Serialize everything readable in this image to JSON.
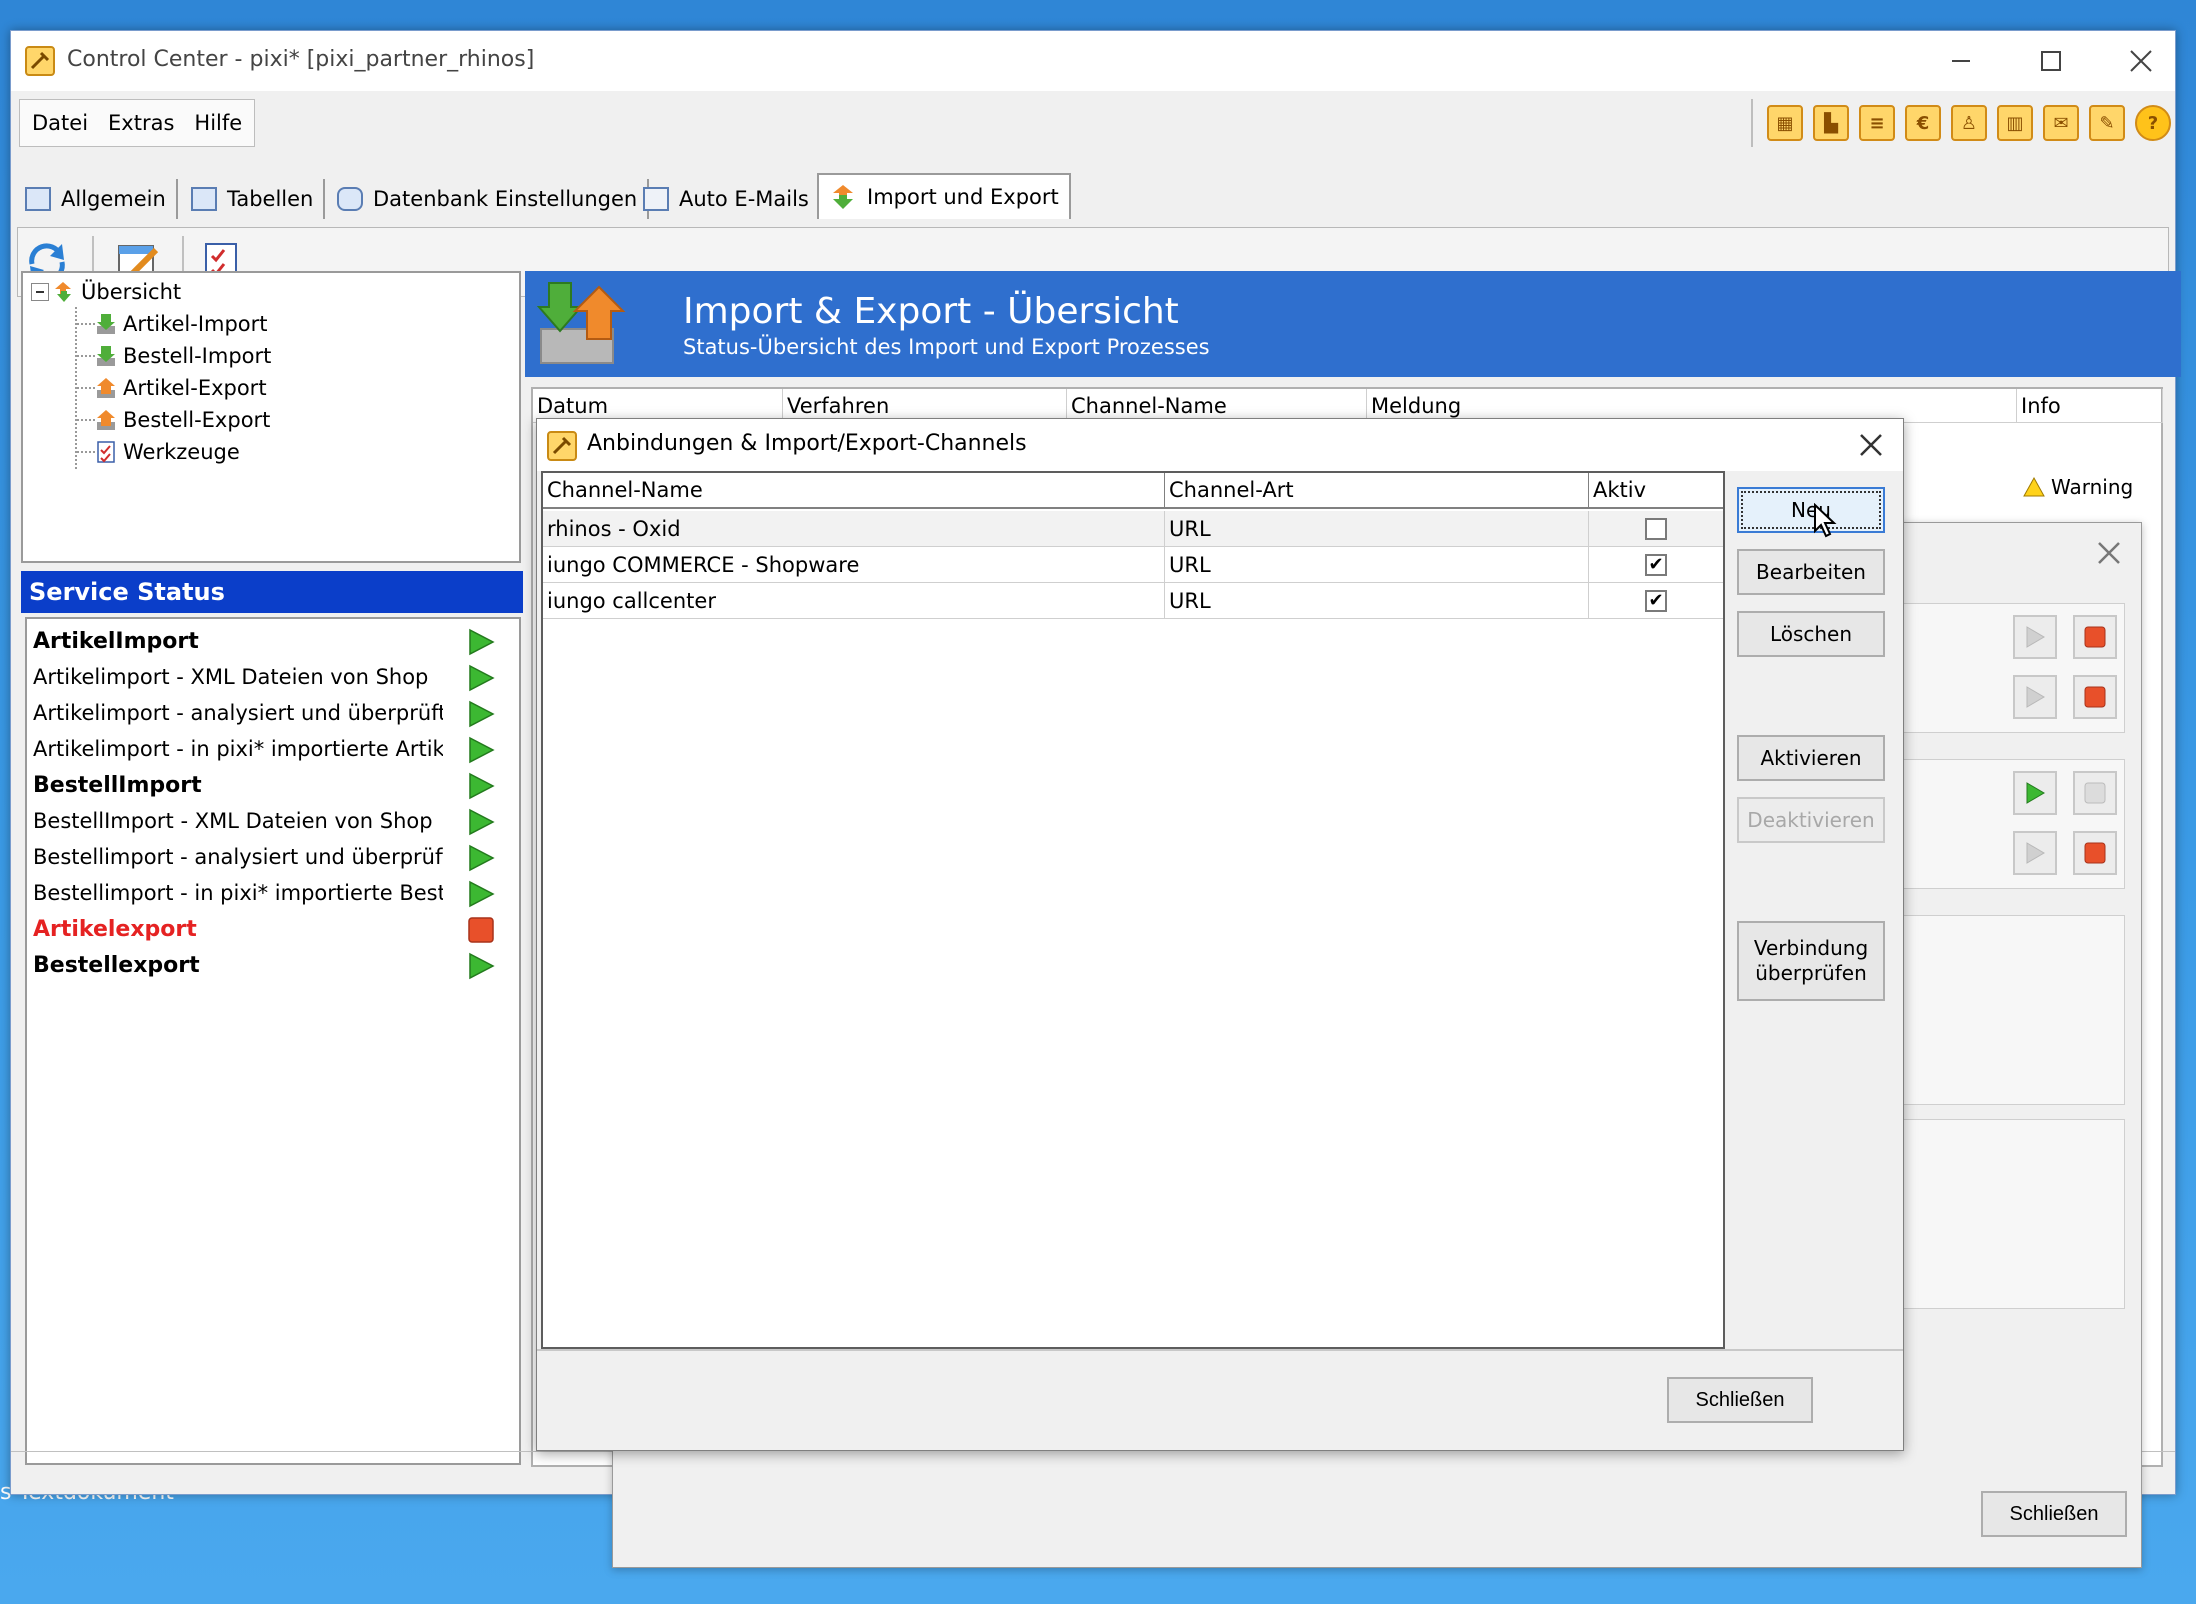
{
  "window": {
    "title": "Control Center - pixi* [pixi_partner_rhinos]"
  },
  "menu": [
    {
      "label": "Datei"
    },
    {
      "label": "Extras"
    },
    {
      "label": "Hilfe"
    }
  ],
  "toolbar_icons": [
    "table-icon",
    "hierarchy-icon",
    "document-icon",
    "euro-icon",
    "user-icon",
    "chart-icon",
    "mail-icon",
    "plugin-icon",
    "help-icon"
  ],
  "toolbar_icon_glyphs": [
    "▦",
    "▙",
    "≡",
    "€",
    "♙",
    "▥",
    "✉",
    "✎",
    "?"
  ],
  "tabs": [
    {
      "label": "Allgemein"
    },
    {
      "label": "Tabellen"
    },
    {
      "label": "Datenbank Einstellungen"
    },
    {
      "label": "Auto E-Mails"
    },
    {
      "label": "Import und Export"
    }
  ],
  "tree": {
    "root": "Übersicht",
    "items": [
      "Artikel-Import",
      "Bestell-Import",
      "Artikel-Export",
      "Bestell-Export",
      "Werkzeuge"
    ]
  },
  "service_status": {
    "title": "Service Status",
    "rows": [
      {
        "label": "ArtikelImport",
        "status": "running"
      },
      {
        "label": "Artikelimport - XML Dateien von Shop",
        "status": "running"
      },
      {
        "label": "Artikelimport - analysiert und überprüft",
        "status": "running"
      },
      {
        "label": "Artikelimport - in pixi* importierte Artikel",
        "status": "running"
      },
      {
        "label": "BestellImport",
        "status": "running"
      },
      {
        "label": "BestellImport - XML Dateien von Shop",
        "status": "running"
      },
      {
        "label": "Bestellimport - analysiert und überprüft",
        "status": "running"
      },
      {
        "label": "Bestellimport - in pixi* importierte Bestellu",
        "status": "running"
      },
      {
        "label": "Artikelexport",
        "status": "stopped"
      },
      {
        "label": "Bestellexport",
        "status": "running"
      }
    ]
  },
  "overview": {
    "title": "Import & Export - Übersicht",
    "subtitle": "Status-Übersicht des Import und Export Prozesses",
    "columns": [
      "Datum",
      "Verfahren",
      "Channel-Name",
      "Meldung",
      "Info"
    ],
    "warning_text": "Warning"
  },
  "channels_dialog": {
    "title": "Anbindungen & Import/Export-Channels",
    "columns": [
      "Channel-Name",
      "Channel-Art",
      "Aktiv"
    ],
    "rows": [
      {
        "name": "rhinos - Oxid",
        "type": "URL",
        "active": false
      },
      {
        "name": "iungo COMMERCE - Shopware",
        "type": "URL",
        "active": true
      },
      {
        "name": "iungo callcenter",
        "type": "URL",
        "active": true
      }
    ],
    "buttons": {
      "new": "Neu",
      "edit": "Bearbeiten",
      "delete": "Löschen",
      "activate": "Aktivieren",
      "deactivate": "Deaktivieren",
      "check_line1": "Verbindung",
      "check_line2": "überprüfen"
    },
    "close": "Schließen"
  },
  "background_dialog": {
    "close": "Schließen"
  },
  "desktop": {
    "label": "s Textdokument"
  },
  "colors": {
    "banner": "#2f6fce",
    "service_header": "#0b3ec9",
    "running": "#3cb832",
    "stopped": "#e8502a",
    "error_text": "#e52222"
  }
}
